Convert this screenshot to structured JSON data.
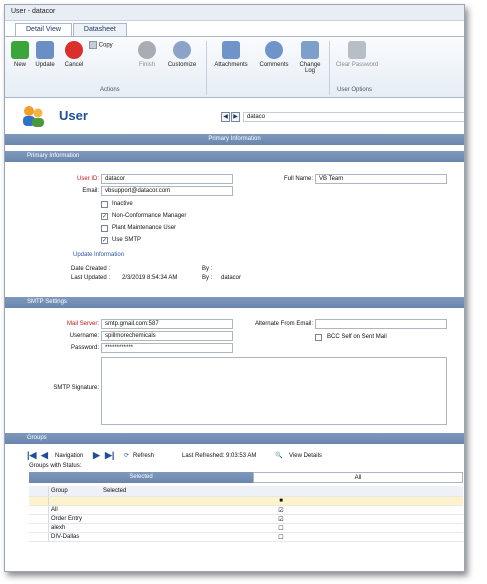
{
  "window": {
    "title": "User - datacor"
  },
  "tabs": [
    "Detail View",
    "Datasheet"
  ],
  "ribbon": {
    "buttons": [
      {
        "label": "New",
        "color": "#3aa63a"
      },
      {
        "label": "Update",
        "color": "#6b8fc4"
      },
      {
        "label": "Cancel",
        "color": "#d9302b"
      },
      {
        "label": "Copy",
        "color": "#c2ccda"
      },
      {
        "label": "Finish",
        "color": "#a9adb3"
      },
      {
        "label": "Customize",
        "color": "#8aa3c7"
      },
      {
        "label": "Attachments",
        "color": "#6f94c9"
      },
      {
        "label": "Comments",
        "color": "#6f94c9"
      },
      {
        "label": "Change Log",
        "color": "#7c9fcc"
      },
      {
        "label": "Clear Password",
        "color": "#b8bec6"
      }
    ],
    "groups": [
      "Actions",
      "User Options"
    ]
  },
  "header": {
    "title": "User",
    "record": "dataco",
    "bar": "Primary Information"
  },
  "primary": {
    "section": "Primary Information",
    "user_id_label": "User ID:",
    "user_id": "datacor",
    "email_label": "Email:",
    "email": "vbsupport@datacor.com",
    "full_name_label": "Full Name:",
    "full_name": "VB Team",
    "checks": [
      {
        "label": "Inactive",
        "checked": false
      },
      {
        "label": "Non-Conformance Manager",
        "checked": true
      },
      {
        "label": "Plant Maintenance User",
        "checked": false
      },
      {
        "label": "Use SMTP",
        "checked": true
      }
    ],
    "update_info": "Update Information",
    "date_created_label": "Date Created :",
    "date_created": "",
    "by1_label": "By :",
    "by1": "",
    "last_updated_label": "Last Updated :",
    "last_updated": "2/3/2019 8:54:34 AM",
    "by2_label": "By :",
    "by2": "datacor"
  },
  "smtp": {
    "section": "SMTP Settings",
    "server_label": "Mail Server:",
    "server": "smtp.gmail.com:587",
    "username_label": "Username:",
    "username": "spillmorechemicals",
    "password_label": "Password:",
    "password": "************",
    "alt_email_label": "Alternate From Email:",
    "alt_email": "",
    "bcc_label": "BCC Self on Sent Mail",
    "signature_label": "SMTP Signature:"
  },
  "groups": {
    "section": "Groups",
    "nav_label": "Navigation",
    "refresh_label": "Refresh",
    "last_refreshed": "Last Refreshed: 9:03:53 AM",
    "view_details": "View Details",
    "status_label": "Groups with Status:",
    "filter_tabs": [
      "Selected",
      "All"
    ],
    "col_group": "Group",
    "col_selected": "Selected",
    "rows": [
      {
        "name": "",
        "selected": "partial"
      },
      {
        "name": "All",
        "selected": "checked"
      },
      {
        "name": "Order Entry",
        "selected": "checked"
      },
      {
        "name": "alexh",
        "selected": "empty"
      },
      {
        "name": "DIV-Dallas",
        "selected": "empty"
      }
    ]
  }
}
